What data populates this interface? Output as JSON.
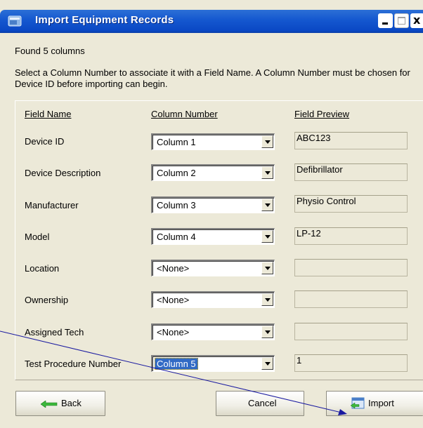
{
  "window": {
    "title": "Import Equipment Records",
    "close_glyph": "x"
  },
  "found_text": "Found 5 columns",
  "instructions": "Select a Column Number to associate it with a Field Name. A Column Number must be chosen for Device ID before importing can begin.",
  "headers": {
    "field_name": "Field Name",
    "column_number": "Column Number",
    "field_preview": "Field Preview"
  },
  "rows": [
    {
      "field": "Device ID",
      "column": "Column 1",
      "preview": "ABC123"
    },
    {
      "field": "Device Description",
      "column": "Column 2",
      "preview": "Defibrillator"
    },
    {
      "field": "Manufacturer",
      "column": "Column 3",
      "preview": "Physio Control"
    },
    {
      "field": "Model",
      "column": "Column 4",
      "preview": "LP-12"
    },
    {
      "field": "Location",
      "column": "<None>",
      "preview": ""
    },
    {
      "field": "Ownership",
      "column": "<None>",
      "preview": ""
    },
    {
      "field": "Assigned Tech",
      "column": "<None>",
      "preview": ""
    },
    {
      "field": "Test Procedure Number",
      "column": "Column 5",
      "preview": "1",
      "selected": true
    }
  ],
  "buttons": {
    "back": "Back",
    "cancel": "Cancel",
    "import": "Import"
  },
  "icons": {
    "app": "app-window-icon",
    "back": "green-left-arrow-icon",
    "import": "import-window-icon"
  },
  "colors": {
    "titlebar": "#0a48c4",
    "selection": "#316ac5",
    "dialog_bg": "#ece9d8",
    "annotation_line": "#1a1aa0"
  }
}
